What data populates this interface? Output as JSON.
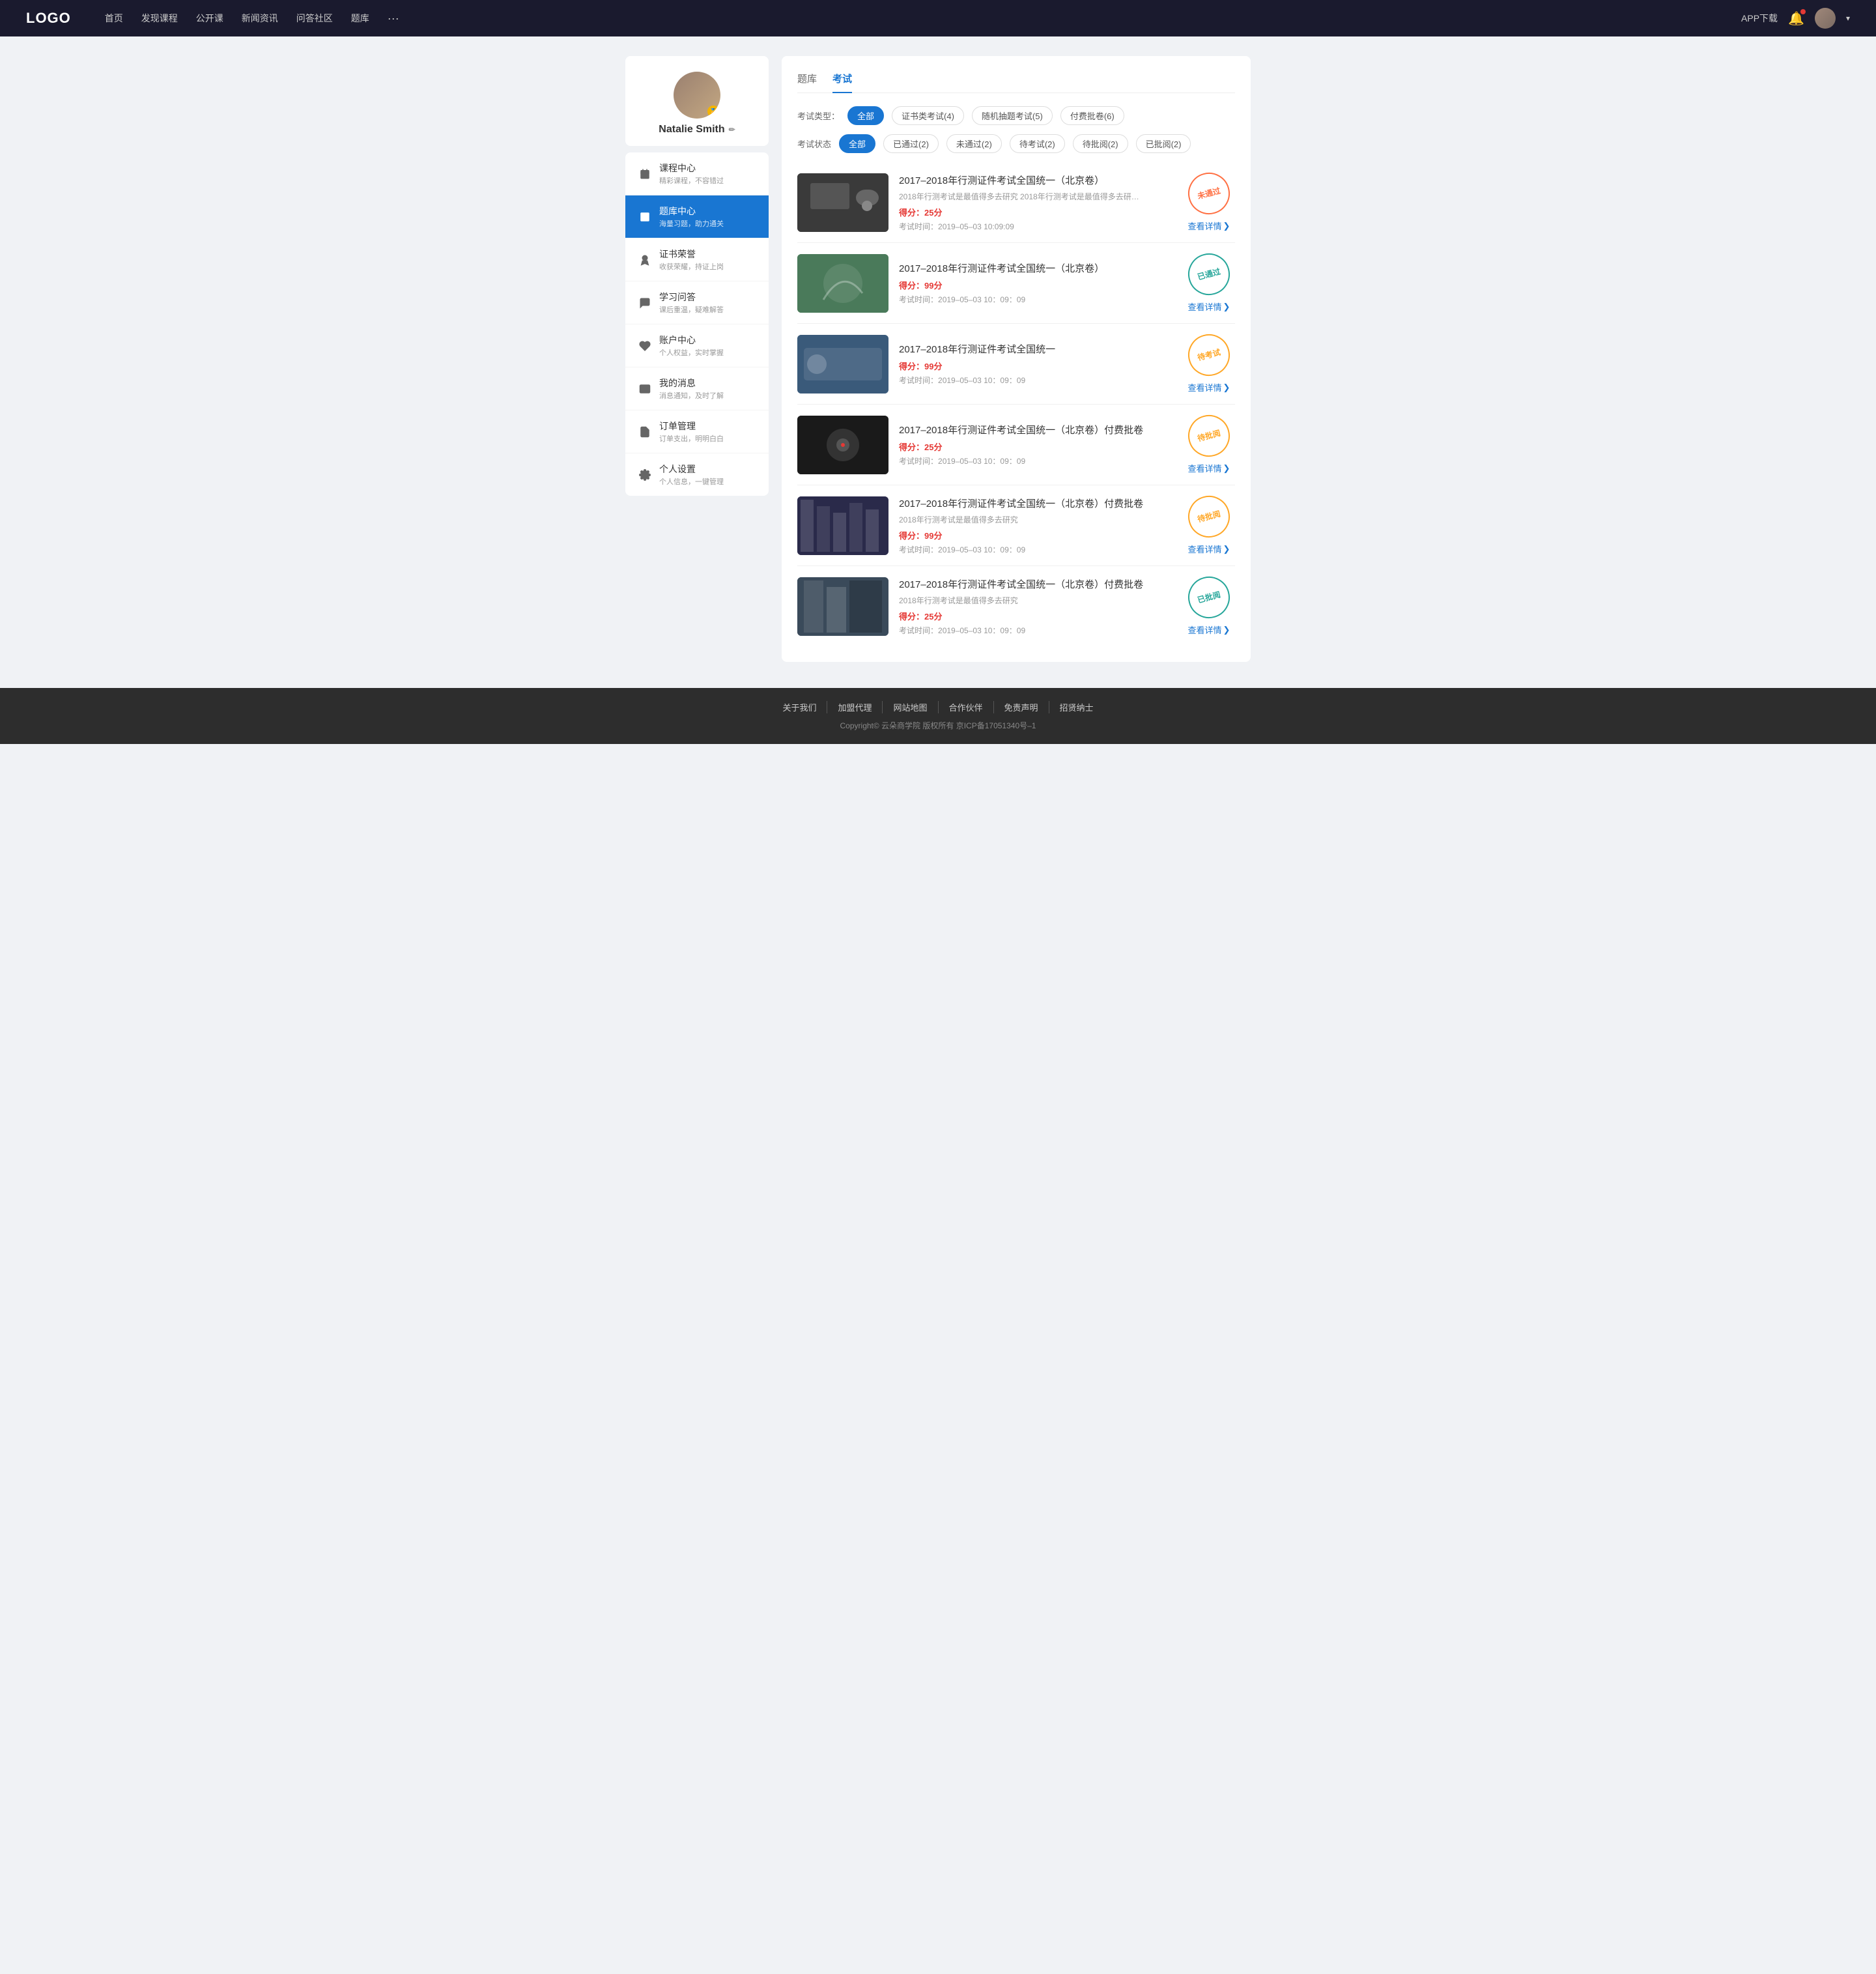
{
  "nav": {
    "logo": "LOGO",
    "links": [
      "首页",
      "发现课程",
      "公开课",
      "新闻资讯",
      "问答社区",
      "题库"
    ],
    "more": "···",
    "app_download": "APP下载",
    "chevron": "▾"
  },
  "sidebar": {
    "profile": {
      "name": "Natalie Smith",
      "edit_icon": "✏"
    },
    "menu": [
      {
        "id": "course",
        "title": "课程中心",
        "subtitle": "精彩课程，不容错过",
        "icon": "calendar"
      },
      {
        "id": "question-bank",
        "title": "题库中心",
        "subtitle": "海量习题，助力通关",
        "icon": "list",
        "active": true
      },
      {
        "id": "certificate",
        "title": "证书荣誉",
        "subtitle": "收获荣耀，持证上岗",
        "icon": "award"
      },
      {
        "id": "qa",
        "title": "学习问答",
        "subtitle": "课后重温，疑难解答",
        "icon": "chat"
      },
      {
        "id": "account",
        "title": "账户中心",
        "subtitle": "个人权益，实时掌握",
        "icon": "heart"
      },
      {
        "id": "messages",
        "title": "我的消息",
        "subtitle": "消息通知，及时了解",
        "icon": "message"
      },
      {
        "id": "orders",
        "title": "订单管理",
        "subtitle": "订单支出，明明白白",
        "icon": "document"
      },
      {
        "id": "settings",
        "title": "个人设置",
        "subtitle": "个人信息，一键管理",
        "icon": "gear"
      }
    ]
  },
  "content": {
    "top_tabs": [
      {
        "label": "题库",
        "active": false
      },
      {
        "label": "考试",
        "active": true
      }
    ],
    "exam_type_label": "考试类型：",
    "exam_type_filters": [
      {
        "label": "全部",
        "active": true
      },
      {
        "label": "证书类考试(4)",
        "active": false
      },
      {
        "label": "随机抽题考试(5)",
        "active": false
      },
      {
        "label": "付费批卷(6)",
        "active": false
      }
    ],
    "exam_status_label": "考试状态",
    "exam_status_filters": [
      {
        "label": "全部",
        "active": true
      },
      {
        "label": "已通过(2)",
        "active": false
      },
      {
        "label": "未通过(2)",
        "active": false
      },
      {
        "label": "待考试(2)",
        "active": false
      },
      {
        "label": "待批阅(2)",
        "active": false
      },
      {
        "label": "已批阅(2)",
        "active": false
      }
    ],
    "exams": [
      {
        "title": "2017–2018年行测证件考试全国统一（北京卷）",
        "desc": "2018年行测考试是最值得多去研究 2018年行测考试是最值得多去研究 2018年行…",
        "score_label": "得分：",
        "score": "25",
        "score_unit": "分",
        "time_label": "考试时间：",
        "time": "2019–05–03  10:09:09",
        "status": "not-passed",
        "status_text": "未通过",
        "thumb_class": "thumb-1",
        "view_detail": "查看详情"
      },
      {
        "title": "2017–2018年行测证件考试全国统一（北京卷）",
        "desc": "",
        "score_label": "得分：",
        "score": "99",
        "score_unit": "分",
        "time_label": "考试时间：",
        "time": "2019–05–03  10：09：09",
        "status": "passed",
        "status_text": "已通过",
        "thumb_class": "thumb-2",
        "view_detail": "查看详情"
      },
      {
        "title": "2017–2018年行测证件考试全国统一",
        "desc": "",
        "score_label": "得分：",
        "score": "99",
        "score_unit": "分",
        "time_label": "考试时间：",
        "time": "2019–05–03  10：09：09",
        "status": "pending",
        "status_text": "待考试",
        "thumb_class": "thumb-3",
        "view_detail": "查看详情"
      },
      {
        "title": "2017–2018年行测证件考试全国统一（北京卷）付费批卷",
        "desc": "",
        "score_label": "得分：",
        "score": "25",
        "score_unit": "分",
        "time_label": "考试时间：",
        "time": "2019–05–03  10：09：09",
        "status": "review",
        "status_text": "待批阅",
        "thumb_class": "thumb-4",
        "view_detail": "查看详情"
      },
      {
        "title": "2017–2018年行测证件考试全国统一（北京卷）付费批卷",
        "desc": "2018年行测考试是最值得多去研究",
        "score_label": "得分：",
        "score": "99",
        "score_unit": "分",
        "time_label": "考试时间：",
        "time": "2019–05–03  10：09：09",
        "status": "review",
        "status_text": "待批阅",
        "thumb_class": "thumb-5",
        "view_detail": "查看详情"
      },
      {
        "title": "2017–2018年行测证件考试全国统一（北京卷）付费批卷",
        "desc": "2018年行测考试是最值得多去研究",
        "score_label": "得分：",
        "score": "25",
        "score_unit": "分",
        "time_label": "考试时间：",
        "time": "2019–05–03  10：09：09",
        "status": "reviewed",
        "status_text": "已批阅",
        "thumb_class": "thumb-6",
        "view_detail": "查看详情"
      }
    ]
  },
  "footer": {
    "links": [
      "关于我们",
      "加盟代理",
      "网站地图",
      "合作伙伴",
      "免责声明",
      "招贤纳士"
    ],
    "copyright": "Copyright© 云朵商学院  版权所有    京ICP备17051340号–1"
  }
}
